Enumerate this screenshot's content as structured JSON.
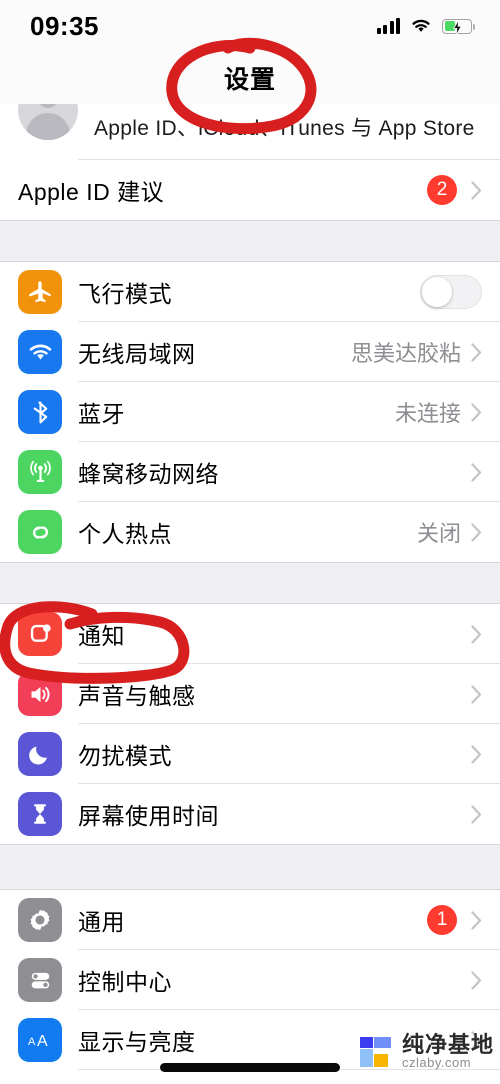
{
  "status_bar": {
    "time": "09:35",
    "signal_icon": "cellular-signal-icon",
    "wifi_icon": "wifi-icon",
    "battery_icon": "battery-charging-icon",
    "battery_level_percent": 42
  },
  "nav": {
    "title": "设置"
  },
  "apple_id_header": {
    "avatar_name": "avatar",
    "subtitle": "Apple ID、iCloud、iTunes 与 App Store"
  },
  "groups": [
    {
      "id": "suggestions",
      "rows": [
        {
          "name": "apple-id-suggestions",
          "label": "Apple ID 建议",
          "value": "",
          "badge": "2",
          "icon": "",
          "icon_color": "",
          "accessory": "chevron"
        }
      ]
    },
    {
      "id": "connectivity",
      "rows": [
        {
          "name": "airplane-mode",
          "label": "飞行模式",
          "value": "",
          "badge": "",
          "icon": "airplane-icon",
          "icon_color": "#f2920b",
          "accessory": "toggle",
          "toggle_on": false
        },
        {
          "name": "wifi",
          "label": "无线局域网",
          "value": "思美达胶粘",
          "badge": "",
          "icon": "wifi-icon",
          "icon_color": "#1878f0",
          "accessory": "chevron"
        },
        {
          "name": "bluetooth",
          "label": "蓝牙",
          "value": "未连接",
          "badge": "",
          "icon": "bluetooth-icon",
          "icon_color": "#1878f0",
          "accessory": "chevron"
        },
        {
          "name": "cellular",
          "label": "蜂窝移动网络",
          "value": "",
          "badge": "",
          "icon": "cellular-antenna-icon",
          "icon_color": "#4cd661",
          "accessory": "chevron"
        },
        {
          "name": "personal-hotspot",
          "label": "个人热点",
          "value": "关闭",
          "badge": "",
          "icon": "hotspot-link-icon",
          "icon_color": "#4cd661",
          "accessory": "chevron"
        }
      ]
    },
    {
      "id": "alerts",
      "rows": [
        {
          "name": "notifications",
          "label": "通知",
          "value": "",
          "badge": "",
          "icon": "notification-badge-icon",
          "icon_color": "#f6443a",
          "accessory": "chevron"
        },
        {
          "name": "sounds-haptics",
          "label": "声音与触感",
          "value": "",
          "badge": "",
          "icon": "speaker-icon",
          "icon_color": "#f33e58",
          "accessory": "chevron"
        },
        {
          "name": "do-not-disturb",
          "label": "勿扰模式",
          "value": "",
          "badge": "",
          "icon": "moon-icon",
          "icon_color": "#5a56d6",
          "accessory": "chevron"
        },
        {
          "name": "screen-time",
          "label": "屏幕使用时间",
          "value": "",
          "badge": "",
          "icon": "hourglass-icon",
          "icon_color": "#5a56d6",
          "accessory": "chevron"
        }
      ]
    },
    {
      "id": "system",
      "rows": [
        {
          "name": "general",
          "label": "通用",
          "value": "",
          "badge": "1",
          "icon": "gear-icon",
          "icon_color": "#8e8e93",
          "accessory": "chevron"
        },
        {
          "name": "control-center",
          "label": "控制中心",
          "value": "",
          "badge": "",
          "icon": "control-center-icon",
          "icon_color": "#8e8e93",
          "accessory": "chevron"
        },
        {
          "name": "display-brightness",
          "label": "显示与亮度",
          "value": "",
          "badge": "",
          "icon": "text-size-aa-icon",
          "icon_color": "#127bf1",
          "accessory": "chevron"
        }
      ]
    }
  ],
  "annotations": {
    "color": "#d81f1f",
    "title_circle": "red-circle-around-settings-title",
    "notifications_circle": "red-circle-around-notifications-row"
  },
  "watermark": {
    "name": "纯净基地",
    "url": "czlaby.com"
  },
  "colors": {
    "badge_red": "#ff3b30",
    "group_background": "#efeff4",
    "row_background": "#ffffff",
    "secondary_text": "#8e8e93",
    "annotation_red": "#d81f1f"
  }
}
